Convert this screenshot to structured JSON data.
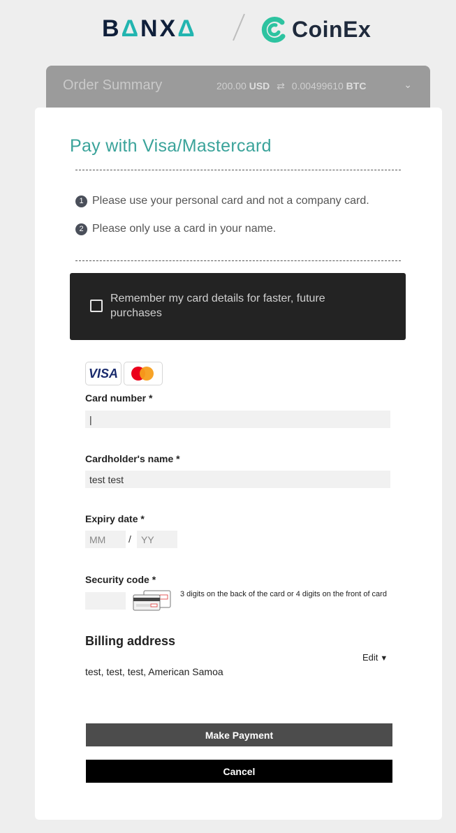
{
  "header": {
    "banxa_prefix": "B",
    "banxa_middle": "NX",
    "coinex": "CoinEx"
  },
  "summary": {
    "title": "Order Summary",
    "fiat_amount": "200.00",
    "fiat_currency": "USD",
    "crypto_amount": "0.00499610",
    "crypto_currency": "BTC"
  },
  "form": {
    "title": "Pay with Visa/Mastercard",
    "notices": [
      {
        "num": "1",
        "text": "Please use your personal card and not a company card."
      },
      {
        "num": "2",
        "text": "Please only use a card in your name."
      }
    ],
    "remember_label": "Remember my card details for faster, future purchases",
    "card_brands": [
      "VISA",
      "Mastercard"
    ],
    "card_number": {
      "label": "Card number *",
      "value": "|"
    },
    "cardholder": {
      "label": "Cardholder's name *",
      "value": "test test"
    },
    "expiry": {
      "label": "Expiry date *",
      "month_placeholder": "MM",
      "separator": "/",
      "year_placeholder": "YY"
    },
    "security": {
      "label": "Security code *",
      "value": "",
      "hint": "3 digits on the back of the card or 4 digits on the front of card"
    },
    "billing": {
      "heading": "Billing address",
      "edit_label": "Edit",
      "address": "test, test, test, American Samoa"
    },
    "pay_button": "Make Payment",
    "cancel_button": "Cancel"
  },
  "colors": {
    "accent": "#3aa39a",
    "summary_bg": "#9b9b9b",
    "remember_bg": "#232323",
    "pay_button_bg": "#4c4c4c",
    "cancel_button_bg": "#000000"
  }
}
